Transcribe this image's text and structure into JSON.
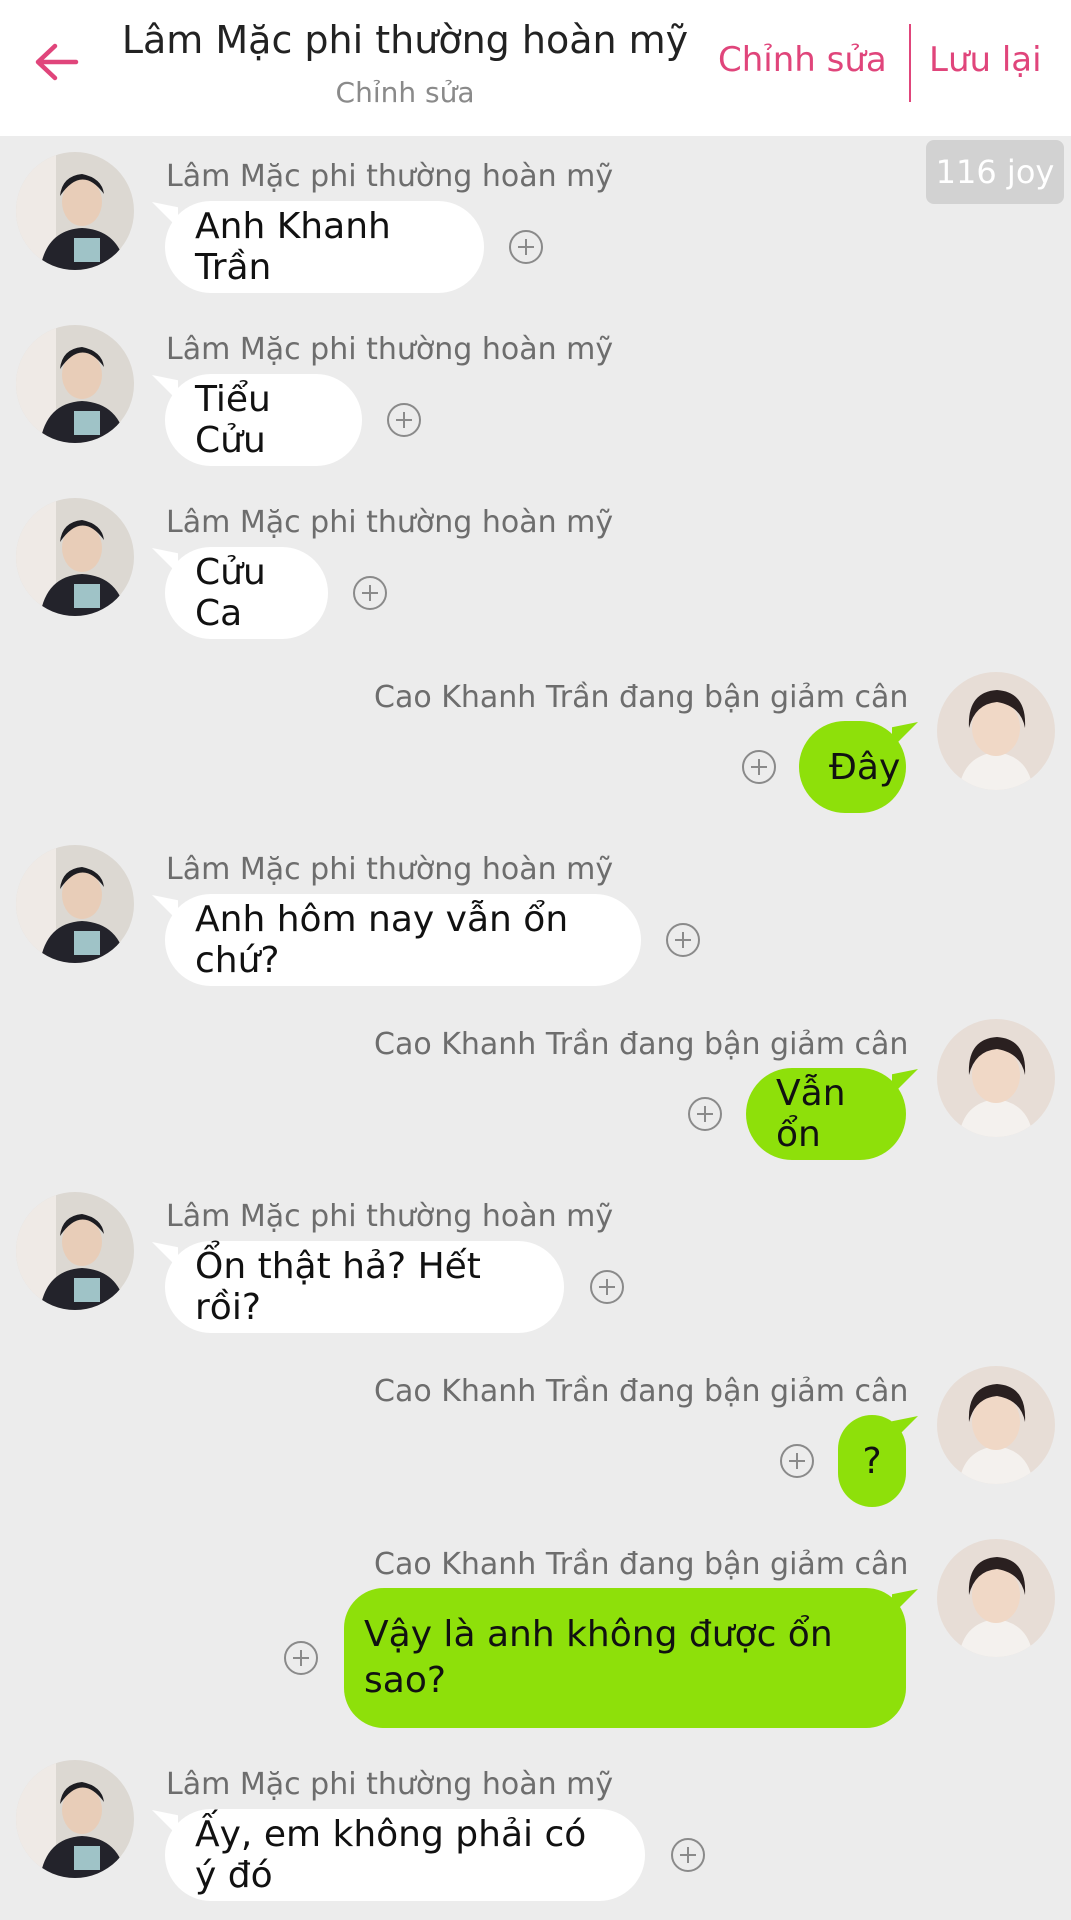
{
  "header": {
    "title": "Lâm Mặc phi thường hoàn mỹ",
    "subtitle": "Chỉnh sửa",
    "edit_label": "Chỉnh sửa",
    "save_label": "Lưu lại",
    "back_icon": "arrow-left-icon",
    "accent_color": "#e0457b"
  },
  "joy_badge": "116 joy",
  "colors": {
    "background": "#ececec",
    "bubble_left": "#ffffff",
    "bubble_right": "#8ee00a"
  },
  "messages": [
    {
      "side": "left",
      "sender": "Lâm Mặc phi thường hoàn mỹ",
      "text": "Anh Khanh Trần"
    },
    {
      "side": "left",
      "sender": "Lâm Mặc phi thường hoàn mỹ",
      "text": "Tiểu Cửu"
    },
    {
      "side": "left",
      "sender": "Lâm Mặc phi thường hoàn mỹ",
      "text": "Cửu Ca"
    },
    {
      "side": "right",
      "sender": "Cao Khanh Trần đang bận giảm cân",
      "text": "Đây"
    },
    {
      "side": "left",
      "sender": "Lâm Mặc phi thường hoàn mỹ",
      "text": "Anh hôm nay vẫn ổn chứ?"
    },
    {
      "side": "right",
      "sender": "Cao Khanh Trần đang bận giảm cân",
      "text": "Vẫn ổn"
    },
    {
      "side": "left",
      "sender": "Lâm Mặc phi thường hoàn mỹ",
      "text": "Ổn thật hả? Hết rồi?"
    },
    {
      "side": "right",
      "sender": "Cao Khanh Trần đang bận giảm cân",
      "text": "?"
    },
    {
      "side": "right",
      "sender": "Cao Khanh Trần đang bận giảm cân",
      "text": "Vậy là anh không được ổn sao?"
    },
    {
      "side": "left",
      "sender": "Lâm Mặc phi thường hoàn mỹ",
      "text": "Ấy, em không phải có ý đó"
    }
  ]
}
